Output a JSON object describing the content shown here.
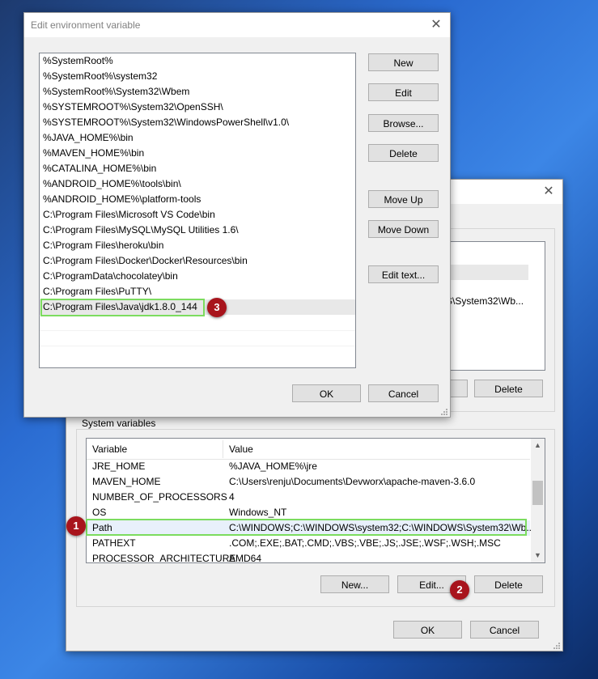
{
  "edit_dialog": {
    "title": "Edit environment variable",
    "entries": [
      "%SystemRoot%",
      "%SystemRoot%\\system32",
      "%SystemRoot%\\System32\\Wbem",
      "%SYSTEMROOT%\\System32\\OpenSSH\\",
      "%SYSTEMROOT%\\System32\\WindowsPowerShell\\v1.0\\",
      "%JAVA_HOME%\\bin",
      "%MAVEN_HOME%\\bin",
      "%CATALINA_HOME%\\bin",
      "%ANDROID_HOME%\\tools\\bin\\",
      "%ANDROID_HOME%\\platform-tools",
      "C:\\Program Files\\Microsoft VS Code\\bin",
      "C:\\Program Files\\MySQL\\MySQL Utilities 1.6\\",
      "C:\\Program Files\\heroku\\bin",
      "C:\\Program Files\\Docker\\Docker\\Resources\\bin",
      "C:\\ProgramData\\chocolatey\\bin",
      "C:\\Program Files\\PuTTY\\",
      "C:\\Program Files\\Java\\jdk1.8.0_144"
    ],
    "buttons": {
      "new": "New",
      "edit": "Edit",
      "browse": "Browse...",
      "delete": "Delete",
      "move_up": "Move Up",
      "move_down": "Move Down",
      "edit_text": "Edit text...",
      "ok": "OK",
      "cancel": "Cancel"
    }
  },
  "env_dialog": {
    "user_list_partial": "S\\System32\\Wb...",
    "user_delete": "Delete",
    "system_group_label": "System variables",
    "columns": {
      "variable": "Variable",
      "value": "Value"
    },
    "rows": [
      {
        "name": "JRE_HOME",
        "value": "%JAVA_HOME%\\jre"
      },
      {
        "name": "MAVEN_HOME",
        "value": "C:\\Users\\renju\\Documents\\Devworx\\apache-maven-3.6.0"
      },
      {
        "name": "NUMBER_OF_PROCESSORS",
        "value": "4"
      },
      {
        "name": "OS",
        "value": "Windows_NT"
      },
      {
        "name": "Path",
        "value": "C:\\WINDOWS;C:\\WINDOWS\\system32;C:\\WINDOWS\\System32\\Wb..."
      },
      {
        "name": "PATHEXT",
        "value": ".COM;.EXE;.BAT;.CMD;.VBS;.VBE;.JS;.JSE;.WSF;.WSH;.MSC"
      },
      {
        "name": "PROCESSOR_ARCHITECTURE",
        "value": "AMD64"
      }
    ],
    "buttons": {
      "new": "New...",
      "edit": "Edit...",
      "delete": "Delete",
      "ok": "OK",
      "cancel": "Cancel"
    }
  },
  "annotations": {
    "step1": "1",
    "step2": "2",
    "step3": "3"
  },
  "colors": {
    "highlight": "#7cdc5f",
    "marker": "#a8141c"
  }
}
